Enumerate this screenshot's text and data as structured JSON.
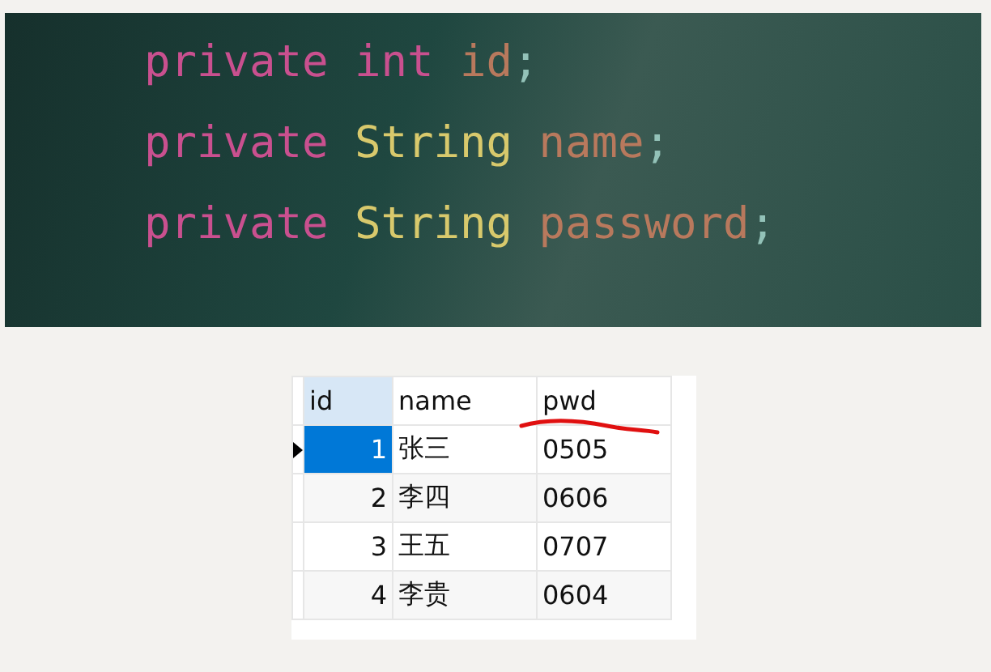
{
  "code_lines": [
    [
      {
        "kind": "keyword",
        "text": "private"
      },
      {
        "kind": "keyword",
        "text": "int"
      },
      {
        "kind": "identifier",
        "text": "id"
      },
      {
        "kind": "punct",
        "text": ";"
      }
    ],
    [
      {
        "kind": "keyword",
        "text": "private"
      },
      {
        "kind": "type",
        "text": "String"
      },
      {
        "kind": "identifier",
        "text": "name"
      },
      {
        "kind": "punct",
        "text": ";"
      }
    ],
    [
      {
        "kind": "keyword",
        "text": "private"
      },
      {
        "kind": "type",
        "text": "String"
      },
      {
        "kind": "identifier",
        "text": "password"
      },
      {
        "kind": "punct",
        "text": ";"
      }
    ]
  ],
  "table": {
    "columns": [
      {
        "label": "id",
        "selected": true
      },
      {
        "label": "name",
        "selected": false
      },
      {
        "label": "pwd",
        "selected": false
      }
    ],
    "rows": [
      {
        "selected": true,
        "cells": [
          "1",
          "张三",
          "0505"
        ]
      },
      {
        "selected": false,
        "cells": [
          "2",
          "李四",
          "0606"
        ]
      },
      {
        "selected": false,
        "cells": [
          "3",
          "王五",
          "0707"
        ]
      },
      {
        "selected": false,
        "cells": [
          "4",
          "李贵",
          "0604"
        ]
      }
    ]
  }
}
